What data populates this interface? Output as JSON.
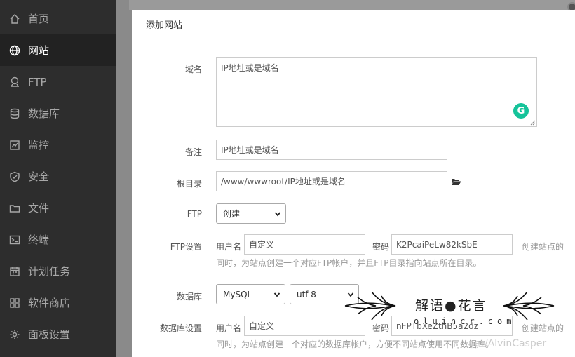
{
  "sidebar": {
    "items": [
      {
        "label": "首页",
        "icon": "home-icon",
        "active": false
      },
      {
        "label": "网站",
        "icon": "globe-icon",
        "active": true
      },
      {
        "label": "FTP",
        "icon": "ftp-icon",
        "active": false
      },
      {
        "label": "数据库",
        "icon": "database-icon",
        "active": false
      },
      {
        "label": "监控",
        "icon": "monitor-icon",
        "active": false
      },
      {
        "label": "安全",
        "icon": "shield-icon",
        "active": false
      },
      {
        "label": "文件",
        "icon": "folder-icon",
        "active": false
      },
      {
        "label": "终端",
        "icon": "terminal-icon",
        "active": false
      },
      {
        "label": "计划任务",
        "icon": "calendar-icon",
        "active": false
      },
      {
        "label": "软件商店",
        "icon": "grid-icon",
        "active": false
      },
      {
        "label": "面板设置",
        "icon": "gear-icon",
        "active": false
      }
    ]
  },
  "modal": {
    "title": "添加网站",
    "domain": {
      "label": "域名",
      "placeholder": "IP地址或是域名"
    },
    "remark": {
      "label": "备注",
      "placeholder": "IP地址或是域名"
    },
    "root": {
      "label": "根目录",
      "value": "/www/wwwroot/IP地址或是域名"
    },
    "ftp": {
      "label": "FTP",
      "selected": "创建"
    },
    "ftp_settings": {
      "label": "FTP设置",
      "user_label": "用户名",
      "user_value": "自定义",
      "pass_label": "密码",
      "pass_value": "K2PcaiPeLw82kSbE",
      "hint_right": "创建站点的",
      "hint_line2": "同时，为站点创建一个对应FTP帐户，并且FTP目录指向站点所在目录。"
    },
    "database": {
      "label": "数据库",
      "type": "MySQL",
      "charset": "utf-8"
    },
    "db_settings": {
      "label": "数据库设置",
      "user_label": "用户名",
      "user_value": "自定义",
      "pass_label": "密码",
      "pass_value": "nFPTbXeZthB5a2dz",
      "hint_right": "创建站点的",
      "hint_line2": "同时，为站点创建一个对应的数据库帐户，方便不同站点使用不同数据库。"
    },
    "grammarly_letter": "G"
  },
  "watermark": {
    "title": "解语●花言",
    "subtitle": "oluincr.com",
    "url": "net/AlvinCasper"
  }
}
